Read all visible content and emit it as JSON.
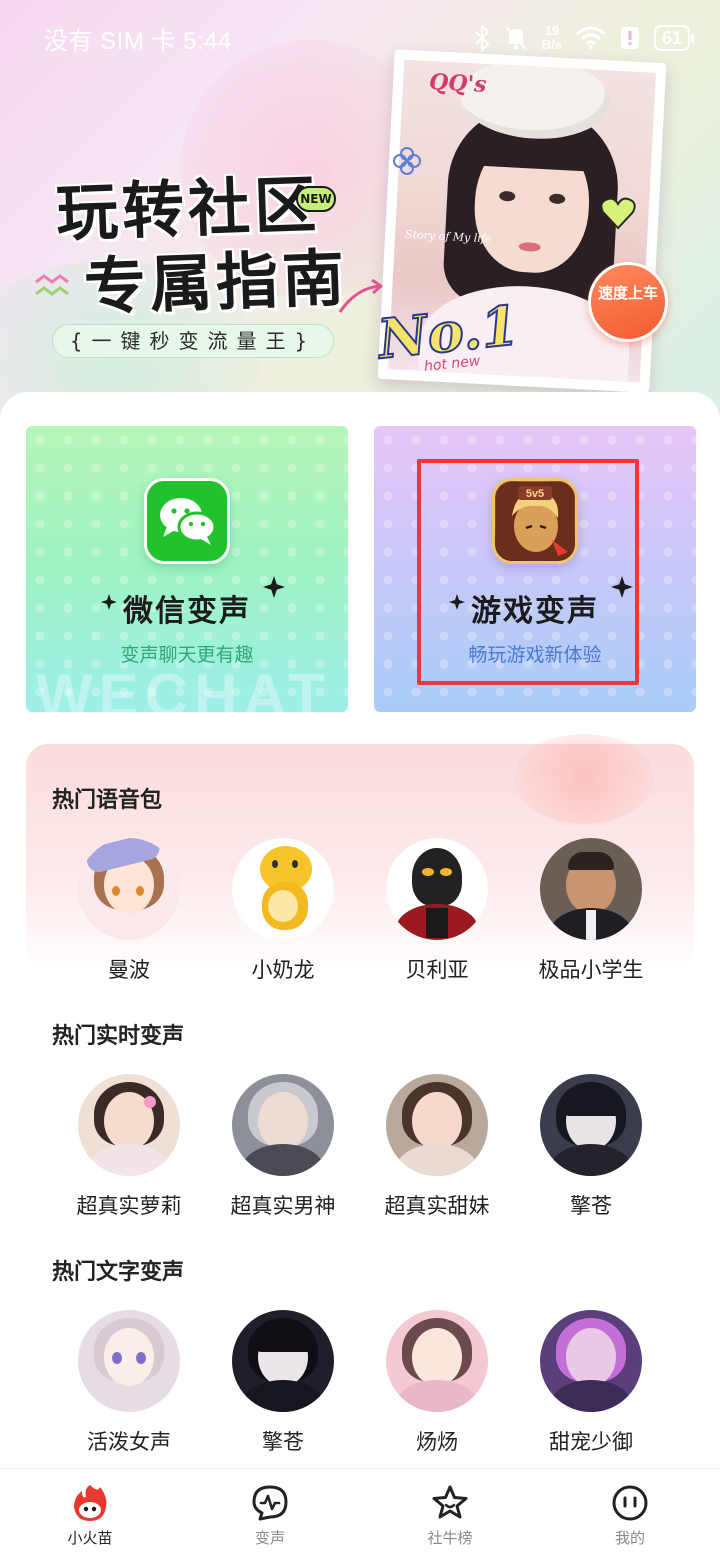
{
  "status_bar": {
    "carrier": "没有 SIM 卡 5:44",
    "network_speed_value": "19",
    "network_speed_unit": "B/s",
    "battery": "61"
  },
  "banner": {
    "title_line1": "玩转社区",
    "title_line2": "专属指南",
    "new_badge": "NEW",
    "subtitle": "{一键秒变流量王}",
    "photo_tag": "QQ's",
    "photo_caption": "Story of My life",
    "no1_text": "No.1",
    "hot_new": "hot new",
    "cta": "速度上车"
  },
  "features": [
    {
      "title": "微信变声",
      "subtitle": "变声聊天更有趣",
      "icon": "wechat-icon",
      "watermark": "WECHAT"
    },
    {
      "title": "游戏变声",
      "subtitle": "畅玩游戏新体验",
      "icon": "game-icon",
      "watermark": ""
    }
  ],
  "sections": {
    "hot_voice_packs": {
      "title": "热门语音包",
      "items": [
        {
          "name": "曼波"
        },
        {
          "name": "小奶龙"
        },
        {
          "name": "贝利亚"
        },
        {
          "name": "极品小学生"
        }
      ]
    },
    "hot_realtime": {
      "title": "热门实时变声",
      "items": [
        {
          "name": "超真实萝莉"
        },
        {
          "name": "超真实男神"
        },
        {
          "name": "超真实甜妹"
        },
        {
          "name": "擎苍"
        }
      ]
    },
    "hot_text": {
      "title": "热门文字变声",
      "items": [
        {
          "name": "活泼女声"
        },
        {
          "name": "擎苍"
        },
        {
          "name": "炀炀"
        },
        {
          "name": "甜宠少御"
        }
      ]
    }
  },
  "tabbar": {
    "items": [
      {
        "label": "小火苗",
        "icon": "flame-icon",
        "active": true
      },
      {
        "label": "变声",
        "icon": "voice-wave-icon",
        "active": false
      },
      {
        "label": "社牛榜",
        "icon": "star-icon",
        "active": false
      },
      {
        "label": "我的",
        "icon": "profile-face-icon",
        "active": false
      }
    ]
  },
  "colors": {
    "highlight": "#f0363b",
    "wechat_green": "#22c22d",
    "flame_red": "#e8392f"
  }
}
